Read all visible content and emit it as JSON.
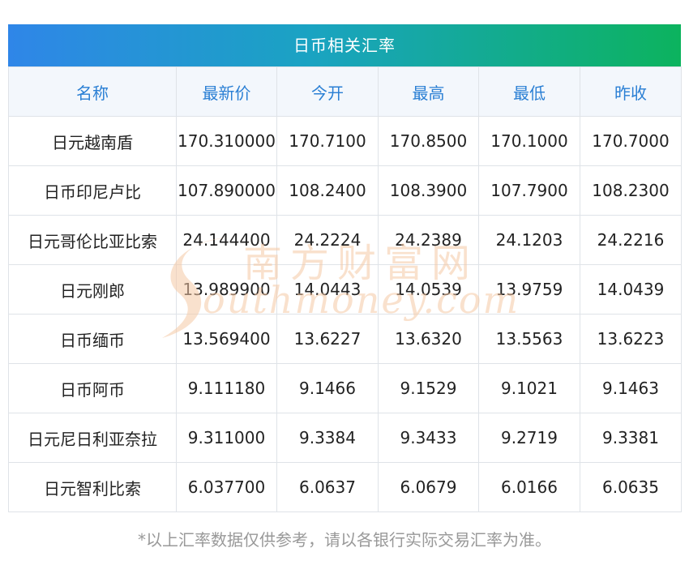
{
  "title": "日币相关汇率",
  "headers": [
    "名称",
    "最新价",
    "今开",
    "最高",
    "最低",
    "昨收"
  ],
  "rows": [
    [
      "日元越南盾",
      "170.310000",
      "170.7100",
      "170.8500",
      "170.1000",
      "170.7000"
    ],
    [
      "日币印尼卢比",
      "107.890000",
      "108.2400",
      "108.3900",
      "107.7900",
      "108.2300"
    ],
    [
      "日元哥伦比亚比索",
      "24.144400",
      "24.2224",
      "24.2389",
      "24.1203",
      "24.2216"
    ],
    [
      "日元刚郎",
      "13.989900",
      "14.0443",
      "14.0539",
      "13.9759",
      "14.0439"
    ],
    [
      "日币缅币",
      "13.569400",
      "13.6227",
      "13.6320",
      "13.5563",
      "13.6223"
    ],
    [
      "日币阿币",
      "9.111180",
      "9.1466",
      "9.1529",
      "9.1021",
      "9.1463"
    ],
    [
      "日元尼日利亚奈拉",
      "9.311000",
      "9.3384",
      "9.3433",
      "9.2719",
      "9.3381"
    ],
    [
      "日元智利比索",
      "6.037700",
      "6.0637",
      "6.0679",
      "6.0166",
      "6.0635"
    ]
  ],
  "watermark": {
    "cn": "南方财富网",
    "en": "outhmoney.com"
  },
  "footnote": "*以上汇率数据仅供参考，请以各银行实际交易汇率为准。",
  "colors": {
    "title_gradient_start": "#2f86e8",
    "title_gradient_end": "#0cb35e",
    "header_text": "#2a7fd4",
    "header_bg": "#f3f7fc",
    "watermark": "#f5c9a6"
  }
}
